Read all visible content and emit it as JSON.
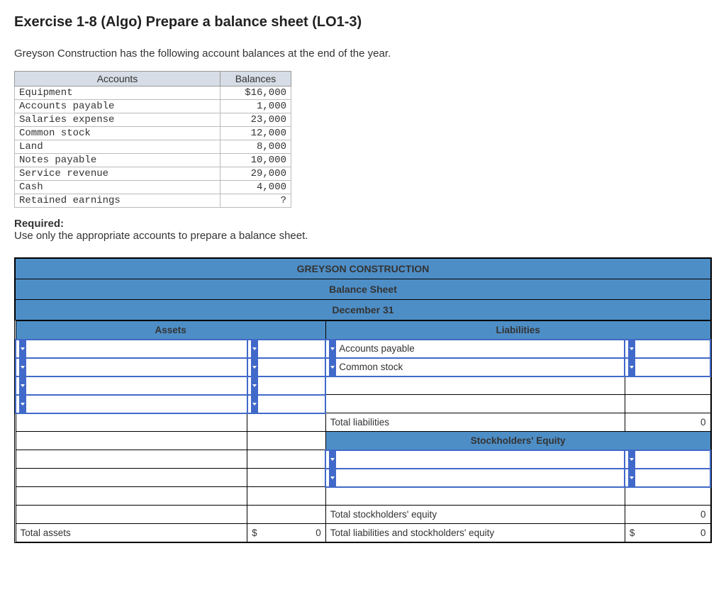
{
  "title": "Exercise 1-8 (Algo) Prepare a balance sheet (LO1-3)",
  "intro": "Greyson Construction has the following account balances at the end of the year.",
  "accounts_table": {
    "headers": {
      "accounts": "Accounts",
      "balances": "Balances"
    },
    "rows": [
      {
        "name": "Equipment",
        "bal": "$16,000"
      },
      {
        "name": "Accounts payable",
        "bal": "1,000"
      },
      {
        "name": "Salaries expense",
        "bal": "23,000"
      },
      {
        "name": "Common stock",
        "bal": "12,000"
      },
      {
        "name": "Land",
        "bal": "8,000"
      },
      {
        "name": "Notes payable",
        "bal": "10,000"
      },
      {
        "name": "Service revenue",
        "bal": "29,000"
      },
      {
        "name": "Cash",
        "bal": "4,000"
      },
      {
        "name": "Retained earnings",
        "bal": "?"
      }
    ]
  },
  "required": {
    "label": "Required:",
    "text": "Use only the appropriate accounts to prepare a balance sheet."
  },
  "bs": {
    "company": "GREYSON CONSTRUCTION",
    "statement": "Balance Sheet",
    "date": "December 31",
    "sections": {
      "assets": "Assets",
      "liabilities": "Liabilities",
      "equity": "Stockholders' Equity"
    },
    "line_items": {
      "liab1": "Accounts payable",
      "liab2": "Common stock"
    },
    "totals": {
      "total_liab_label": "Total liabilities",
      "total_liab_val": "0",
      "total_equity_label": "Total stockholders' equity",
      "total_equity_val": "0",
      "total_liab_equity_label": "Total liabilities and stockholders' equity",
      "total_liab_equity_sym": "$",
      "total_liab_equity_val": "0",
      "total_assets_label": "Total assets",
      "total_assets_sym": "$",
      "total_assets_val": "0"
    }
  }
}
